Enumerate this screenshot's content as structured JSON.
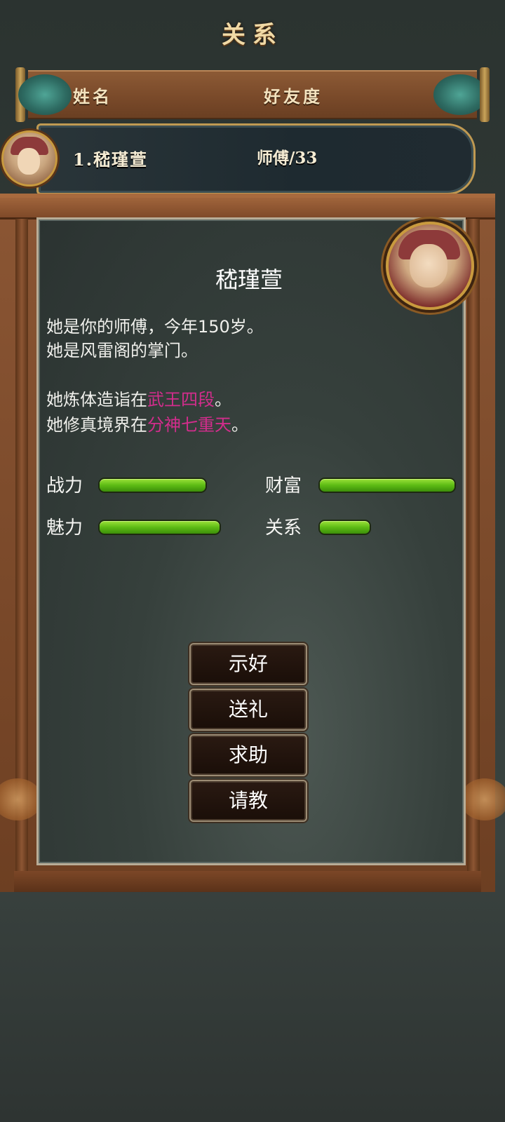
{
  "header": {
    "title": "关系"
  },
  "columns": {
    "name": "姓名",
    "favor": "好友度"
  },
  "list": [
    {
      "name": "1.嵇瑾萱",
      "relation": "师傅/33"
    }
  ],
  "detail": {
    "name": "嵇瑾萱",
    "line1": "她是你的师傅，今年150岁。",
    "line2": "她是风雷阁的掌门。",
    "line3_prefix": "她炼体造诣在",
    "line3_highlight": "武王四段",
    "line3_suffix": "。",
    "line4_prefix": "她修真境界在",
    "line4_highlight": "分神七重天",
    "line4_suffix": "。",
    "highlight_color": "#d22d8c"
  },
  "stats": {
    "combat": {
      "label": "战力",
      "level": 0.86
    },
    "wealth": {
      "label": "财富",
      "level": 1.0
    },
    "charm": {
      "label": "魅力",
      "level": 0.89
    },
    "relation": {
      "label": "关系",
      "level": 0.37
    }
  },
  "actions": {
    "flatter": "示好",
    "gift": "送礼",
    "help": "求助",
    "learn": "请教"
  },
  "colors": {
    "bar": "#5dbb14",
    "frame": "#7a4a2a",
    "roll": "#2e6b62"
  }
}
